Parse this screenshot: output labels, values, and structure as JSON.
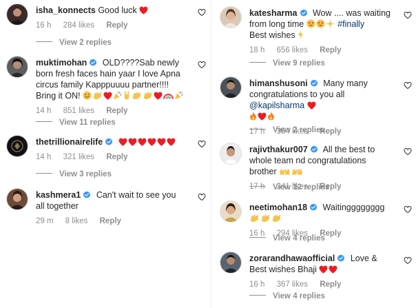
{
  "left": {
    "comments": [
      {
        "username": "isha_konnects",
        "text": "Good luck",
        "time": "16 h",
        "likes": "284 likes",
        "reply": "Reply",
        "view_replies": "View 2 replies"
      },
      {
        "username": "muktimohan",
        "text": "OLD????Sab newly born fresh faces hain yaar  I love Apna circus family Kapppuuuu partner!!!! Bring it ON!",
        "time": "14 h",
        "likes": "851 likes",
        "reply": "Reply",
        "view_replies": "View 11 replies"
      },
      {
        "username": "thetrillionairelife",
        "text": "",
        "time": "14 h",
        "likes": "321 likes",
        "reply": "Reply",
        "view_replies": "View 3 replies"
      },
      {
        "username": "kashmera1",
        "text": "Can't wait to see you all together",
        "time": "29 m",
        "likes": "8 likes",
        "reply": "Reply"
      }
    ]
  },
  "right": {
    "comments": [
      {
        "username": "katesharma",
        "text": "Wow .... was waiting from long time",
        "hashtag": "#finally",
        "text2": "Best wishes",
        "time": "18 h",
        "likes": "656 likes",
        "reply": "Reply",
        "view_replies": "View 9 replies"
      },
      {
        "username": "himanshusoni",
        "text": "Many many congratulations to you all",
        "mention": "@kapilsharma",
        "time": "17 h",
        "likes": "354 likes",
        "reply": "Reply",
        "view_replies": "View 2 replies"
      },
      {
        "username": "rajivthakur007",
        "text": "All the best to whole team nd congratulations brother",
        "time": "17 h",
        "likes": "341 likes",
        "reply": "Reply",
        "view_replies": "View 12 replies"
      },
      {
        "username": "neetimohan18",
        "text": "Waitingggggggg",
        "time": "16 h",
        "likes": "294 likes",
        "reply": "Reply",
        "view_replies": "View 4 replies"
      },
      {
        "username": "zorarandhawaofficial",
        "text": "Love & Best wishes Bhaji",
        "time": "16 h",
        "likes": "367 likes",
        "reply": "Reply",
        "view_replies": "View 4 replies"
      }
    ]
  },
  "colors": {
    "heart": "#ed1c24",
    "verified": "#3897f0",
    "link": "#00376b",
    "muted": "#8e8e8e"
  }
}
